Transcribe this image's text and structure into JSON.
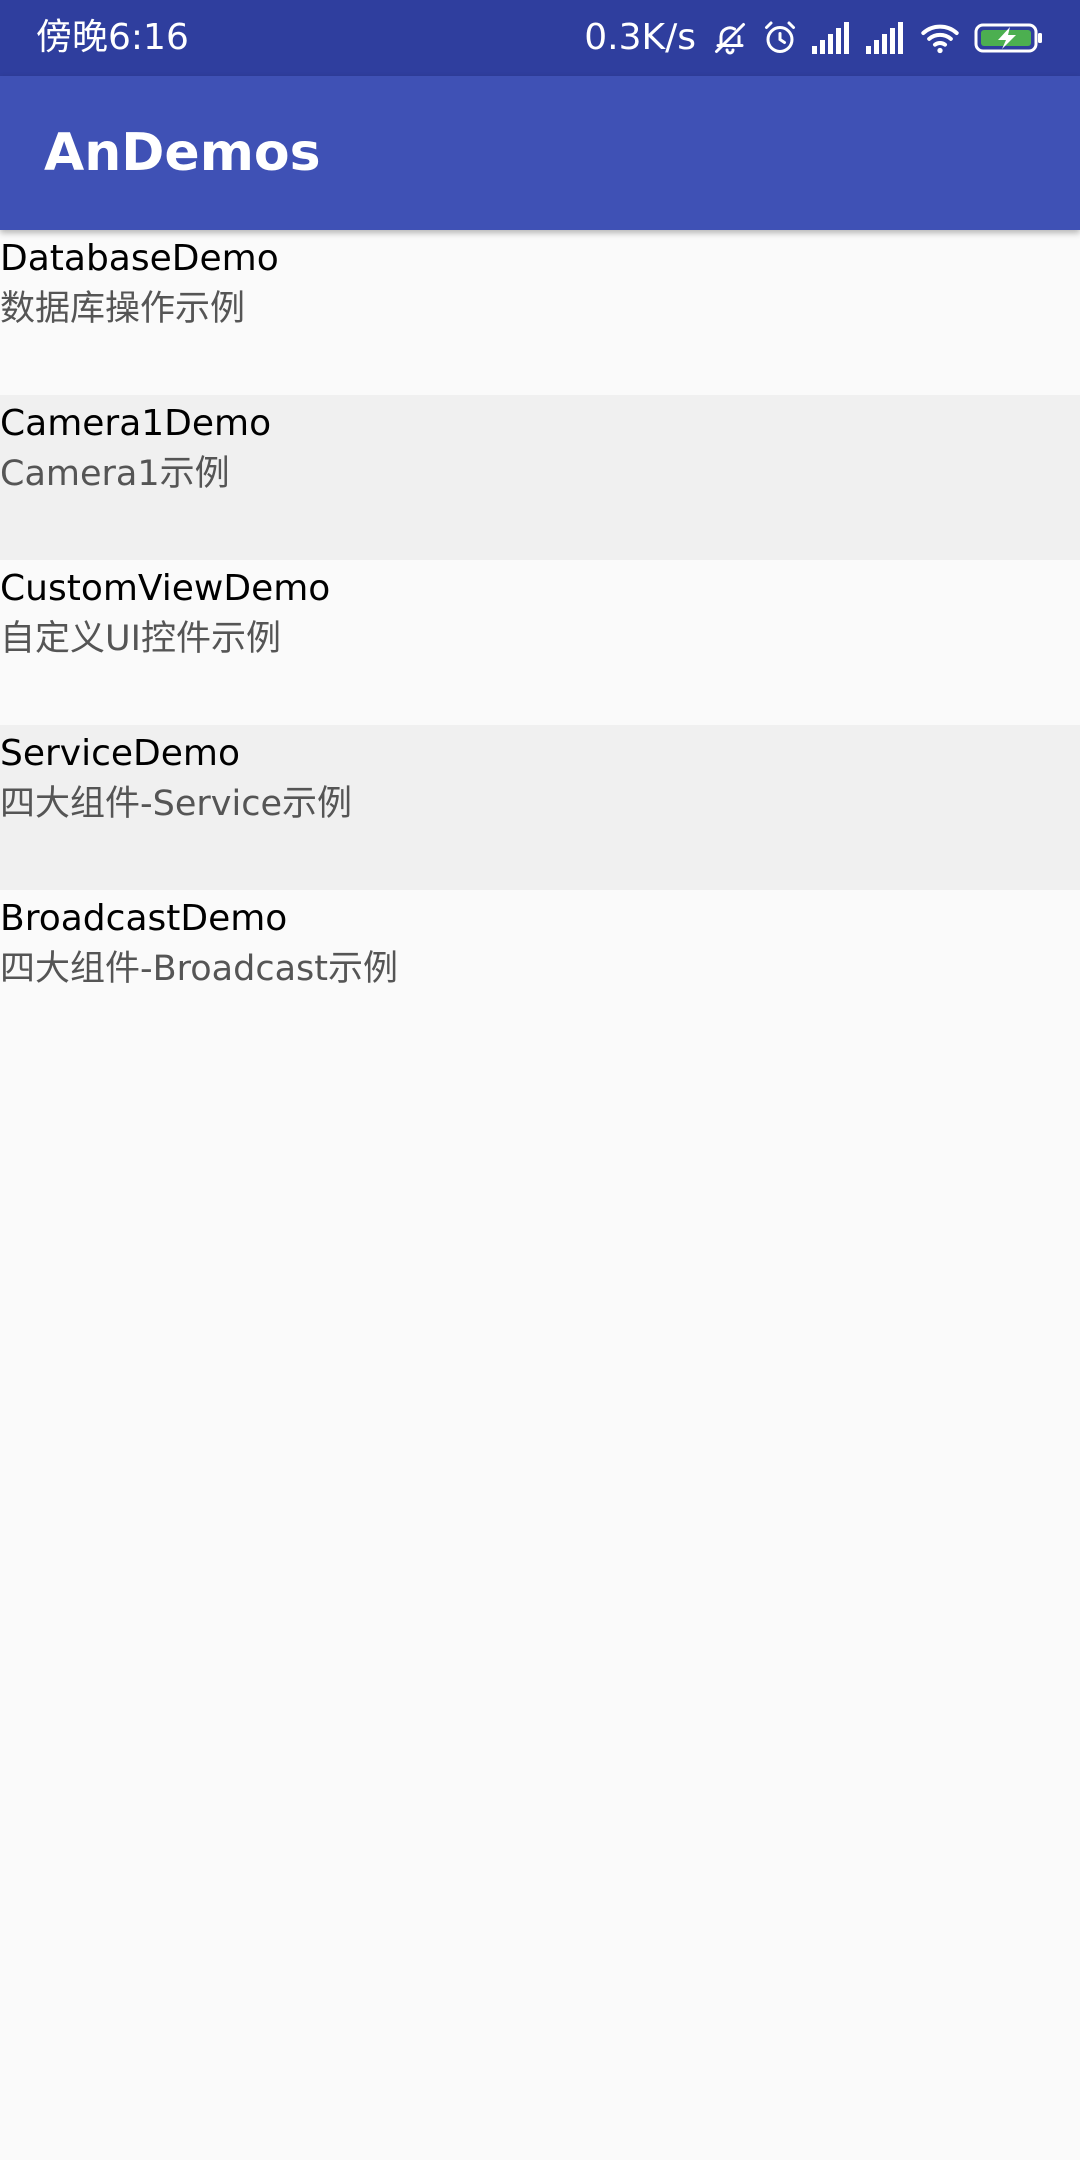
{
  "status_bar": {
    "time": "傍晚6:16",
    "net_speed": "0.3K/s",
    "icons": [
      "bell-muted-icon",
      "alarm-icon",
      "signal-icon",
      "signal-icon",
      "wifi-icon",
      "battery-charging-icon"
    ],
    "background": "#2f3e9e"
  },
  "app_bar": {
    "title": "AnDemos",
    "background": "#3f51b5"
  },
  "list": {
    "items": [
      {
        "title": "DatabaseDemo",
        "subtitle": "数据库操作示例"
      },
      {
        "title": "Camera1Demo",
        "subtitle": "Camera1示例"
      },
      {
        "title": "CustomViewDemo",
        "subtitle": "自定义UI控件示例"
      },
      {
        "title": "ServiceDemo",
        "subtitle": "四大组件-Service示例"
      },
      {
        "title": "BroadcastDemo",
        "subtitle": "四大组件-Broadcast示例"
      }
    ],
    "alt_row_color": "#f0f0f0"
  }
}
